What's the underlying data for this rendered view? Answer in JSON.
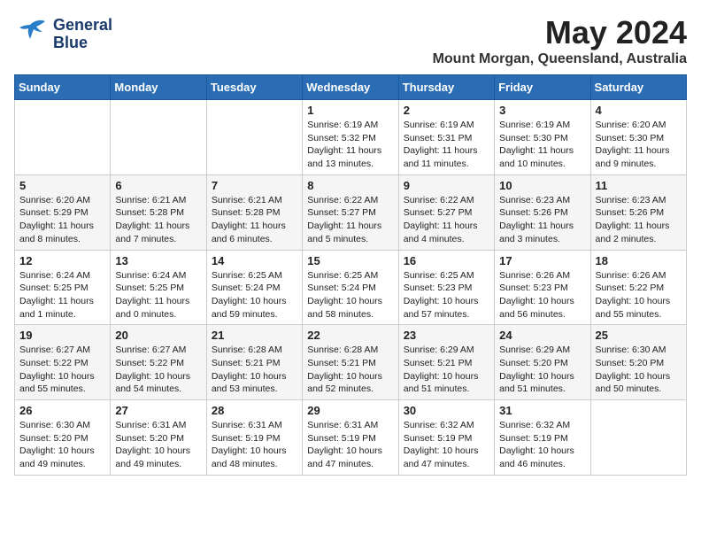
{
  "header": {
    "logo_line1": "General",
    "logo_line2": "Blue",
    "month": "May 2024",
    "location": "Mount Morgan, Queensland, Australia"
  },
  "days_of_week": [
    "Sunday",
    "Monday",
    "Tuesday",
    "Wednesday",
    "Thursday",
    "Friday",
    "Saturday"
  ],
  "weeks": [
    [
      {
        "day": "",
        "info": ""
      },
      {
        "day": "",
        "info": ""
      },
      {
        "day": "",
        "info": ""
      },
      {
        "day": "1",
        "info": "Sunrise: 6:19 AM\nSunset: 5:32 PM\nDaylight: 11 hours\nand 13 minutes."
      },
      {
        "day": "2",
        "info": "Sunrise: 6:19 AM\nSunset: 5:31 PM\nDaylight: 11 hours\nand 11 minutes."
      },
      {
        "day": "3",
        "info": "Sunrise: 6:19 AM\nSunset: 5:30 PM\nDaylight: 11 hours\nand 10 minutes."
      },
      {
        "day": "4",
        "info": "Sunrise: 6:20 AM\nSunset: 5:30 PM\nDaylight: 11 hours\nand 9 minutes."
      }
    ],
    [
      {
        "day": "5",
        "info": "Sunrise: 6:20 AM\nSunset: 5:29 PM\nDaylight: 11 hours\nand 8 minutes."
      },
      {
        "day": "6",
        "info": "Sunrise: 6:21 AM\nSunset: 5:28 PM\nDaylight: 11 hours\nand 7 minutes."
      },
      {
        "day": "7",
        "info": "Sunrise: 6:21 AM\nSunset: 5:28 PM\nDaylight: 11 hours\nand 6 minutes."
      },
      {
        "day": "8",
        "info": "Sunrise: 6:22 AM\nSunset: 5:27 PM\nDaylight: 11 hours\nand 5 minutes."
      },
      {
        "day": "9",
        "info": "Sunrise: 6:22 AM\nSunset: 5:27 PM\nDaylight: 11 hours\nand 4 minutes."
      },
      {
        "day": "10",
        "info": "Sunrise: 6:23 AM\nSunset: 5:26 PM\nDaylight: 11 hours\nand 3 minutes."
      },
      {
        "day": "11",
        "info": "Sunrise: 6:23 AM\nSunset: 5:26 PM\nDaylight: 11 hours\nand 2 minutes."
      }
    ],
    [
      {
        "day": "12",
        "info": "Sunrise: 6:24 AM\nSunset: 5:25 PM\nDaylight: 11 hours\nand 1 minute."
      },
      {
        "day": "13",
        "info": "Sunrise: 6:24 AM\nSunset: 5:25 PM\nDaylight: 11 hours\nand 0 minutes."
      },
      {
        "day": "14",
        "info": "Sunrise: 6:25 AM\nSunset: 5:24 PM\nDaylight: 10 hours\nand 59 minutes."
      },
      {
        "day": "15",
        "info": "Sunrise: 6:25 AM\nSunset: 5:24 PM\nDaylight: 10 hours\nand 58 minutes."
      },
      {
        "day": "16",
        "info": "Sunrise: 6:25 AM\nSunset: 5:23 PM\nDaylight: 10 hours\nand 57 minutes."
      },
      {
        "day": "17",
        "info": "Sunrise: 6:26 AM\nSunset: 5:23 PM\nDaylight: 10 hours\nand 56 minutes."
      },
      {
        "day": "18",
        "info": "Sunrise: 6:26 AM\nSunset: 5:22 PM\nDaylight: 10 hours\nand 55 minutes."
      }
    ],
    [
      {
        "day": "19",
        "info": "Sunrise: 6:27 AM\nSunset: 5:22 PM\nDaylight: 10 hours\nand 55 minutes."
      },
      {
        "day": "20",
        "info": "Sunrise: 6:27 AM\nSunset: 5:22 PM\nDaylight: 10 hours\nand 54 minutes."
      },
      {
        "day": "21",
        "info": "Sunrise: 6:28 AM\nSunset: 5:21 PM\nDaylight: 10 hours\nand 53 minutes."
      },
      {
        "day": "22",
        "info": "Sunrise: 6:28 AM\nSunset: 5:21 PM\nDaylight: 10 hours\nand 52 minutes."
      },
      {
        "day": "23",
        "info": "Sunrise: 6:29 AM\nSunset: 5:21 PM\nDaylight: 10 hours\nand 51 minutes."
      },
      {
        "day": "24",
        "info": "Sunrise: 6:29 AM\nSunset: 5:20 PM\nDaylight: 10 hours\nand 51 minutes."
      },
      {
        "day": "25",
        "info": "Sunrise: 6:30 AM\nSunset: 5:20 PM\nDaylight: 10 hours\nand 50 minutes."
      }
    ],
    [
      {
        "day": "26",
        "info": "Sunrise: 6:30 AM\nSunset: 5:20 PM\nDaylight: 10 hours\nand 49 minutes."
      },
      {
        "day": "27",
        "info": "Sunrise: 6:31 AM\nSunset: 5:20 PM\nDaylight: 10 hours\nand 49 minutes."
      },
      {
        "day": "28",
        "info": "Sunrise: 6:31 AM\nSunset: 5:19 PM\nDaylight: 10 hours\nand 48 minutes."
      },
      {
        "day": "29",
        "info": "Sunrise: 6:31 AM\nSunset: 5:19 PM\nDaylight: 10 hours\nand 47 minutes."
      },
      {
        "day": "30",
        "info": "Sunrise: 6:32 AM\nSunset: 5:19 PM\nDaylight: 10 hours\nand 47 minutes."
      },
      {
        "day": "31",
        "info": "Sunrise: 6:32 AM\nSunset: 5:19 PM\nDaylight: 10 hours\nand 46 minutes."
      },
      {
        "day": "",
        "info": ""
      }
    ]
  ]
}
